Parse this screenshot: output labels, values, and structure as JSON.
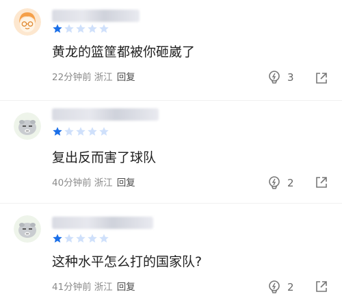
{
  "colors": {
    "star_on": "#1a6fe8",
    "star_off": "#cfe0fb",
    "meta": "#8a8a8a",
    "reply": "#4a4a4a",
    "text": "#1f1f1f"
  },
  "comments": [
    {
      "avatar_icon": "orange-haired-cartoon-avatar",
      "rating": 1,
      "rating_max": 5,
      "content": "黄龙的篮筐都被你砸崴了",
      "time": "22分钟前",
      "location": "浙江",
      "reply_label": "回复",
      "likes": "3"
    },
    {
      "avatar_icon": "grey-cartoon-avatar",
      "rating": 1,
      "rating_max": 5,
      "content": "复出反而害了球队",
      "time": "40分钟前",
      "location": "浙江",
      "reply_label": "回复",
      "likes": "2"
    },
    {
      "avatar_icon": "grey-cartoon-avatar",
      "rating": 1,
      "rating_max": 5,
      "content": "这种水平怎么打的国家队?",
      "time": "41分钟前",
      "location": "浙江",
      "reply_label": "回复",
      "likes": "2"
    }
  ]
}
